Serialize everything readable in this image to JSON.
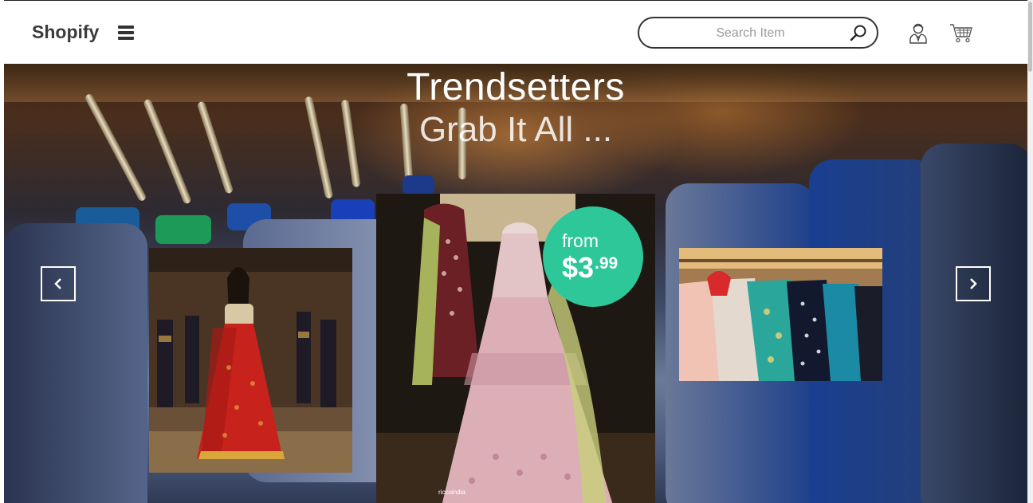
{
  "header": {
    "brand": "Shopify",
    "search_placeholder": "Search Item",
    "search_value": ""
  },
  "hero": {
    "title": "Trendsetters",
    "subtitle": "Grab It All ...",
    "promo": {
      "prefix": "from",
      "price": "$3",
      "cents": ".99"
    },
    "watermark": "riccoindia"
  },
  "colors": {
    "promo_badge": "#2ec79a",
    "brand_text": "#3b3b3b",
    "header_bg": "#ffffff"
  },
  "icons": {
    "menu": "hamburger-icon",
    "search": "search-icon",
    "account": "user-icon",
    "cart": "cart-icon",
    "prev": "chevron-left-icon",
    "next": "chevron-right-icon"
  }
}
